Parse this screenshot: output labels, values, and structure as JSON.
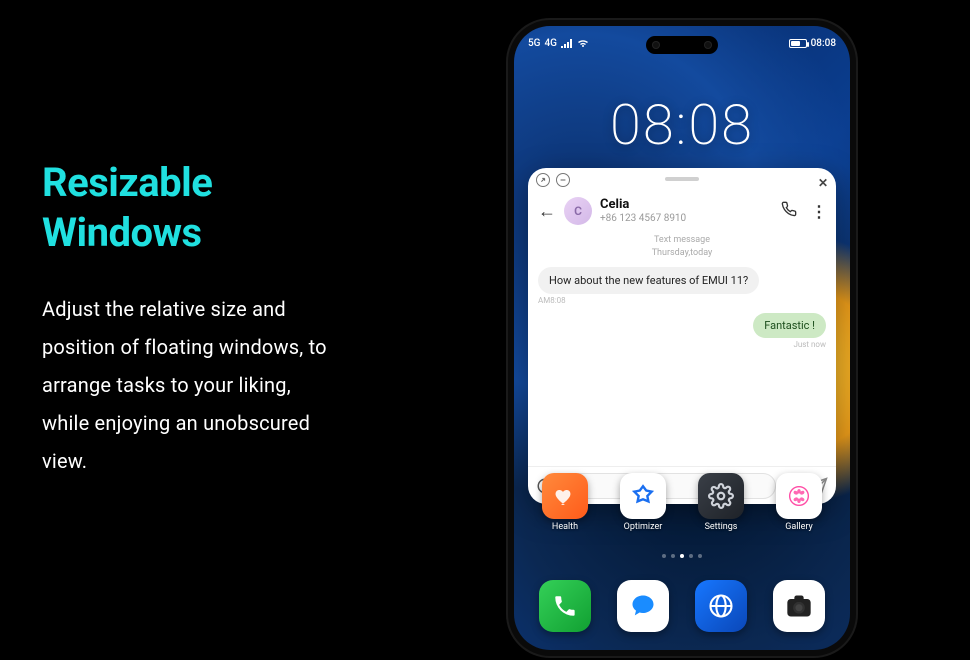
{
  "hero": {
    "title_line1": "Resizable",
    "title_line2": "Windows",
    "description": "Adjust the relative size and position of floating windows, to arrange tasks to your liking, while enjoying an unobscured view."
  },
  "status": {
    "network": "5G",
    "signal": "4G",
    "time": "08:08"
  },
  "clock": "08:08",
  "conversation": {
    "contact_name": "Celia",
    "contact_initial": "C",
    "contact_phone": "+86 123 4567 8910",
    "thread_type": "Text message",
    "thread_date": "Thursday,today",
    "incoming_text": "How about the new features of EMUI 11?",
    "incoming_time": "AM8:08",
    "outgoing_text": "Fantastic !",
    "outgoing_time": "Just now"
  },
  "apps": {
    "health": "Health",
    "optimizer": "Optimizer",
    "settings": "Settings",
    "gallery": "Gallery"
  }
}
